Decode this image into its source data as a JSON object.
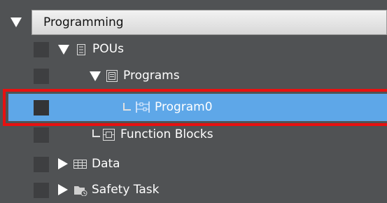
{
  "tree": {
    "root_label": "Programming",
    "pous_label": "POUs",
    "programs_label": "Programs",
    "program0_label": "Program0",
    "function_blocks_label": "Function Blocks",
    "data_label": "Data",
    "safety_task_label": "Safety Task"
  },
  "colors": {
    "background": "#505254",
    "selection": "#5ea7e8",
    "highlight_outline": "#e81010"
  }
}
